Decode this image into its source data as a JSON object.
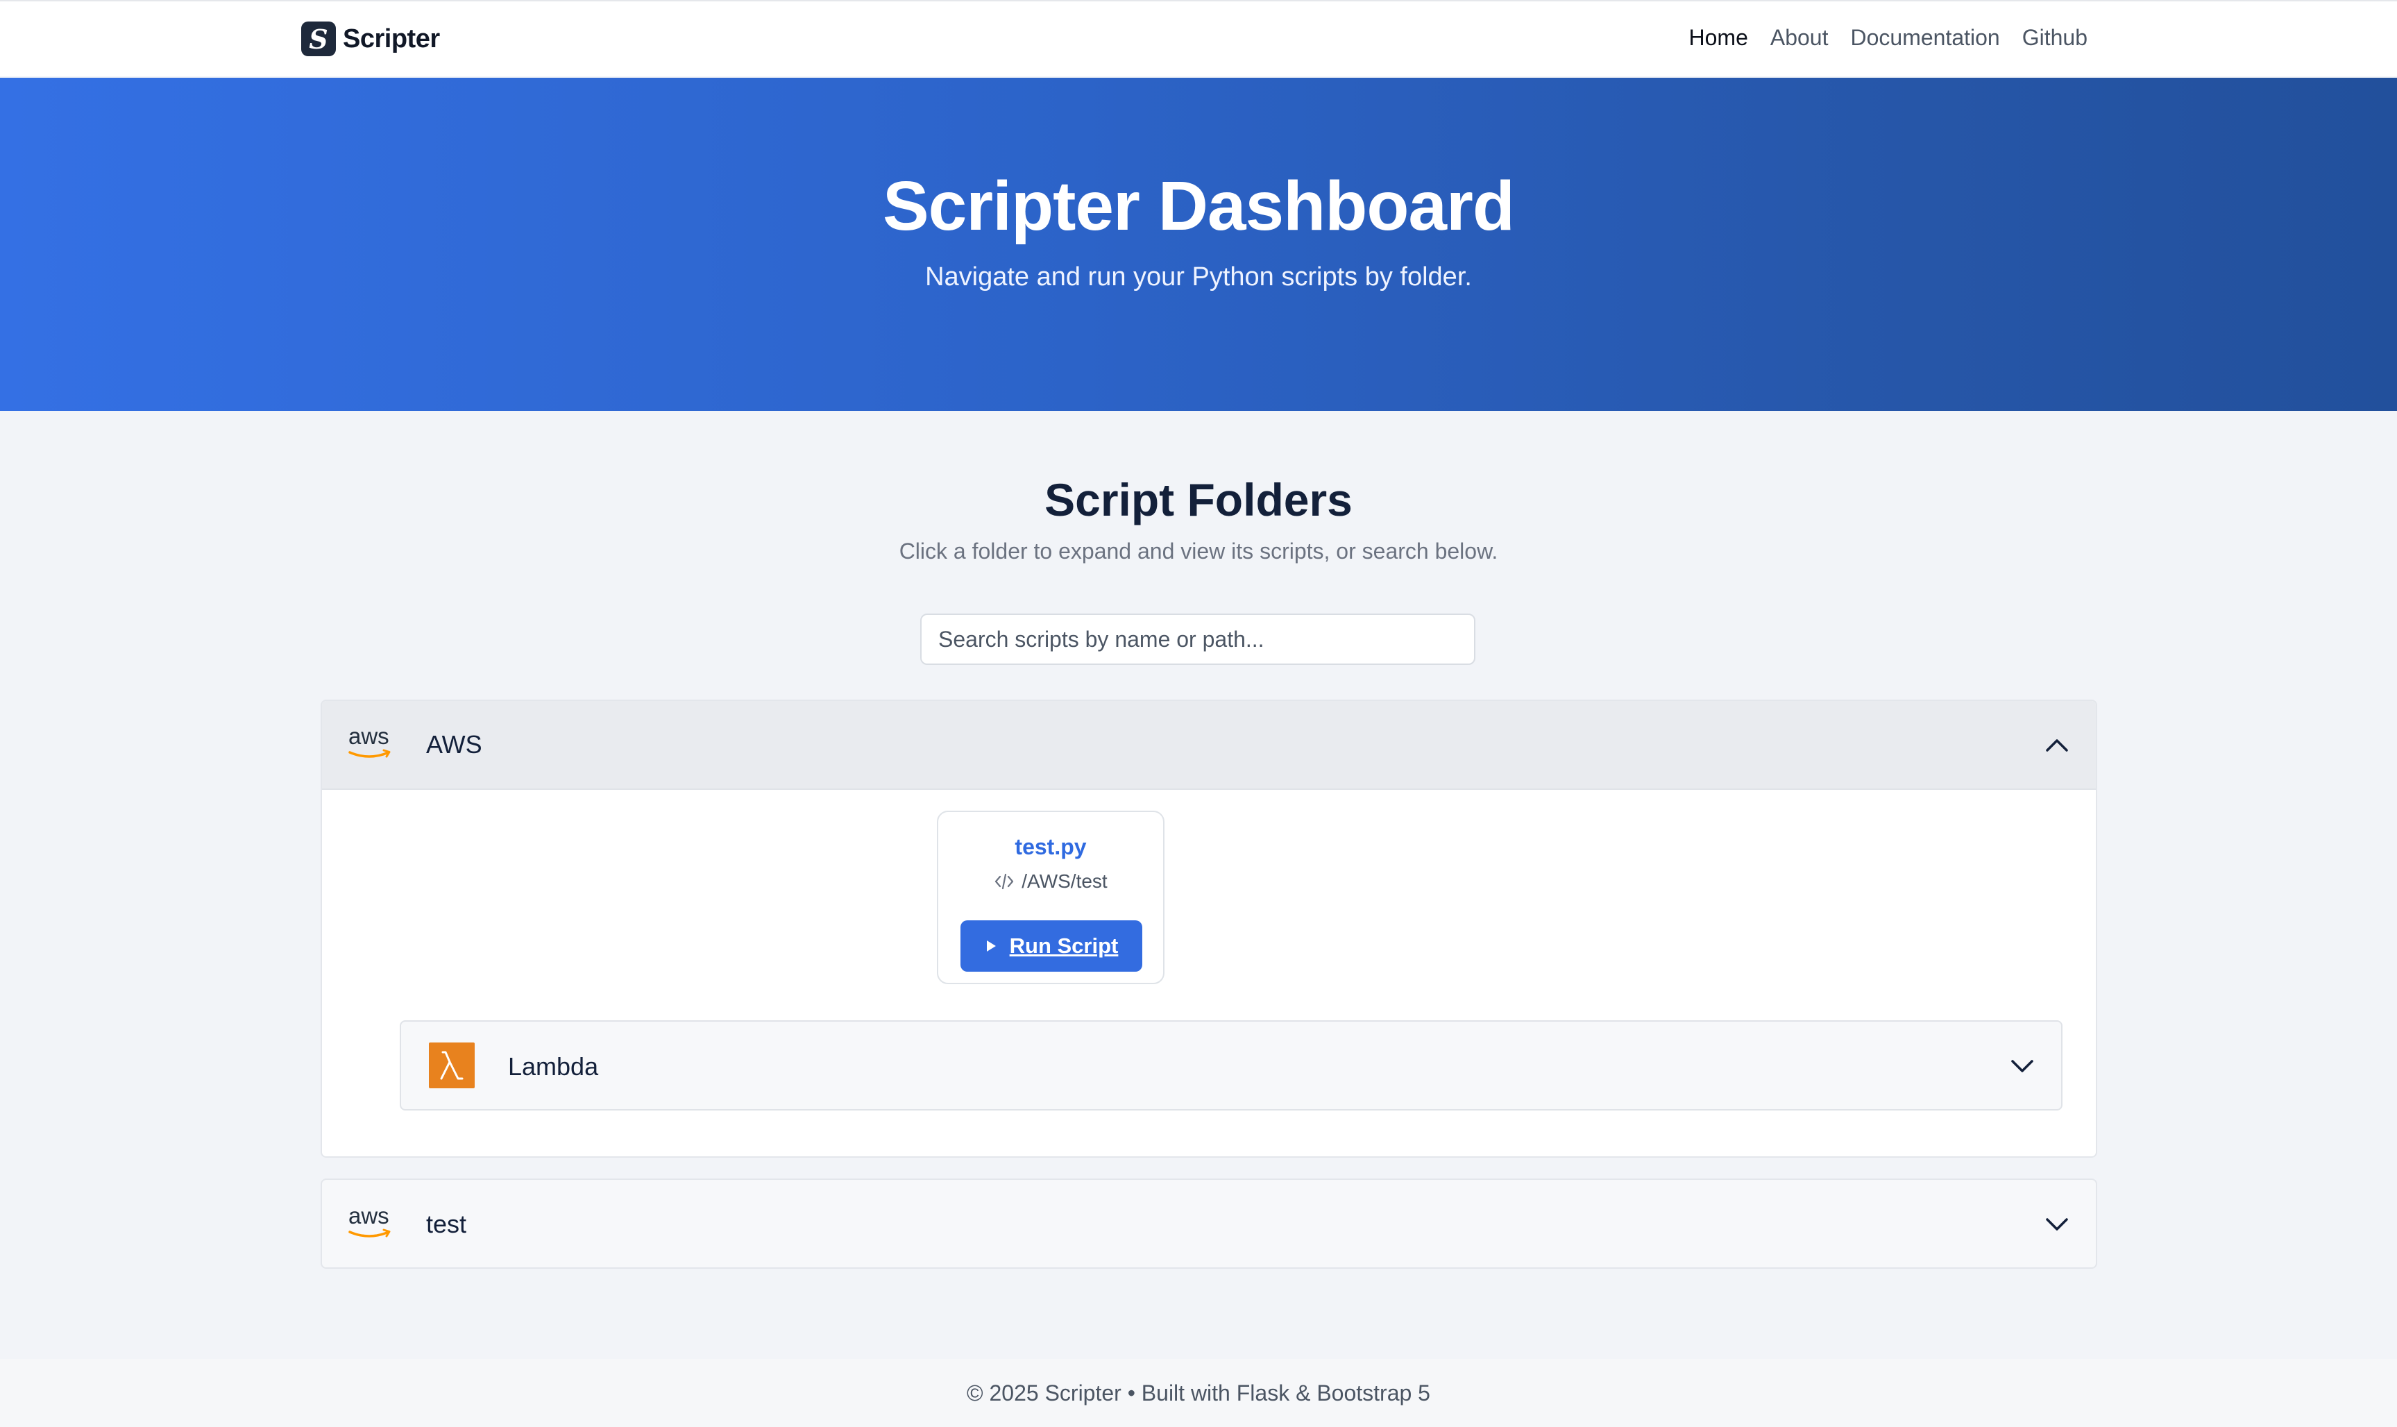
{
  "navbar": {
    "brand": "Scripter",
    "brand_logo_glyph": "S",
    "links": [
      {
        "label": "Home",
        "active": true
      },
      {
        "label": "About",
        "active": false
      },
      {
        "label": "Documentation",
        "active": false
      },
      {
        "label": "Github",
        "active": false
      }
    ]
  },
  "hero": {
    "title": "Scripter Dashboard",
    "subtitle": "Navigate and run your Python scripts by folder."
  },
  "main": {
    "title": "Script Folders",
    "subtitle": "Click a folder to expand and view its scripts, or search below.",
    "search_placeholder": "Search scripts by name or path..."
  },
  "folders": [
    {
      "name": "AWS",
      "logo_text": "aws",
      "icon": "aws-logo-icon",
      "expanded": true,
      "chevron": "chevron-up-icon",
      "scripts": [
        {
          "name": "test.py",
          "path": "/AWS/test",
          "button_label": "Run Script"
        }
      ],
      "subfolders": [
        {
          "name": "Lambda",
          "icon": "lambda-icon",
          "expanded": false,
          "chevron": "chevron-down-icon"
        }
      ]
    },
    {
      "name": "test",
      "logo_text": "aws",
      "icon": "aws-logo-icon",
      "expanded": false,
      "chevron": "chevron-down-icon"
    }
  ],
  "footer": {
    "text": "© 2025 Scripter • Built with Flask & Bootstrap 5"
  },
  "colors": {
    "primary": "#336ce0",
    "hero_start": "#3470e4",
    "hero_end": "#22509c",
    "aws_orange": "#ff9900",
    "lambda_orange": "#e8821e"
  }
}
